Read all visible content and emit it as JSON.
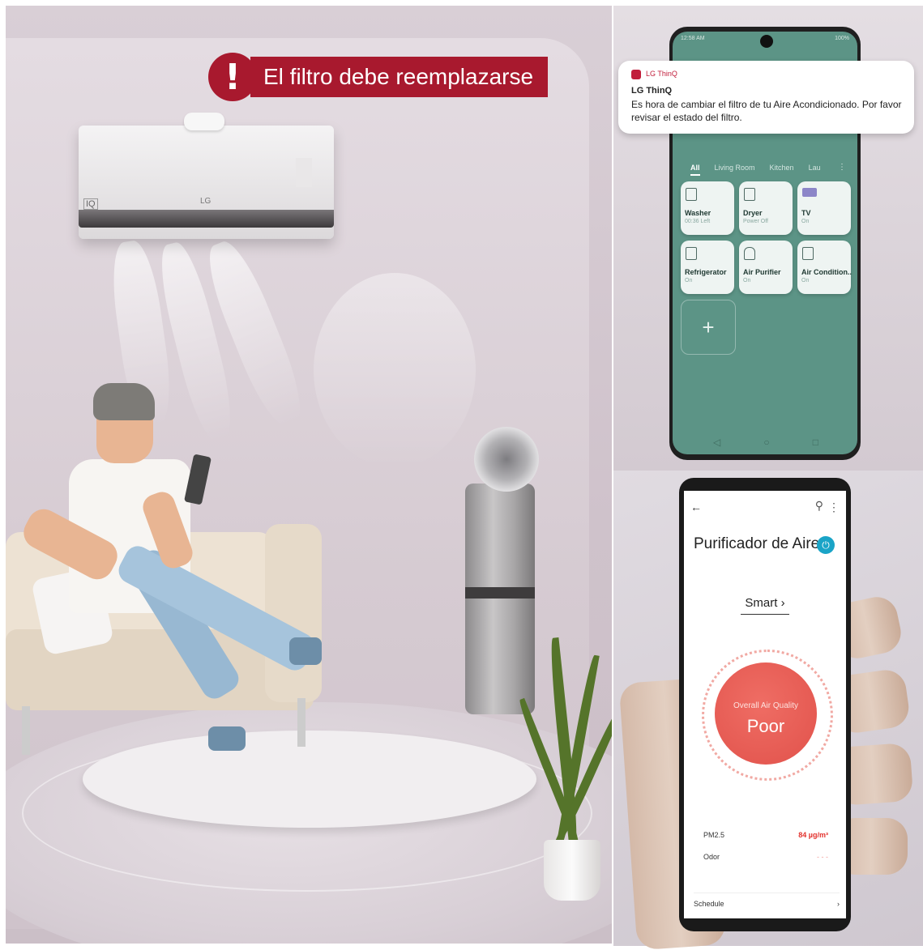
{
  "scene": {
    "alert_icon": "!",
    "alert_text": "El filtro debe reemplazarse",
    "alert_color": "#a8192e",
    "ac_brand": "LG",
    "ac_logo": "IQ"
  },
  "phone_notification": {
    "status_time": "12:58 AM",
    "status_battery": "100%",
    "app_name": "LG ThinQ",
    "title": "LG ThinQ",
    "body": "Es hora de cambiar el filtro de tu Aire Acondicionado. Por favor revisar el estado del filtro.",
    "tabs": [
      "All",
      "Living Room",
      "Kitchen",
      "Lau"
    ],
    "more_icon": "⋮",
    "devices": [
      {
        "name": "Washer",
        "status": "00:36 Left"
      },
      {
        "name": "Dryer",
        "status": "Power Off"
      },
      {
        "name": "TV",
        "status": "On"
      },
      {
        "name": "Refrigerator",
        "status": "On"
      },
      {
        "name": "Air Purifier",
        "status": "On"
      },
      {
        "name": "Air Condition..",
        "status": "On"
      }
    ],
    "add_label": "+",
    "nav": [
      "◁",
      "○",
      "□"
    ],
    "screen_color": "#5c9486"
  },
  "phone_purifier": {
    "back_icon": "←",
    "ai_icon": "⚲",
    "menu_icon": "⋮",
    "title": "Purificador de Aire",
    "power_icon": "⏻",
    "mode": "Smart ›",
    "aq_label": "Overall Air Quality",
    "aq_value": "Poor",
    "pm_label": "PM2.5",
    "pm_value": "84 µg/m³",
    "odor_label": "Odor",
    "odor_value": "- - -",
    "schedule_label": "Schedule",
    "schedule_arrow": "›",
    "accent_color": "#1aa4c7",
    "aq_color": "#e1524b"
  }
}
